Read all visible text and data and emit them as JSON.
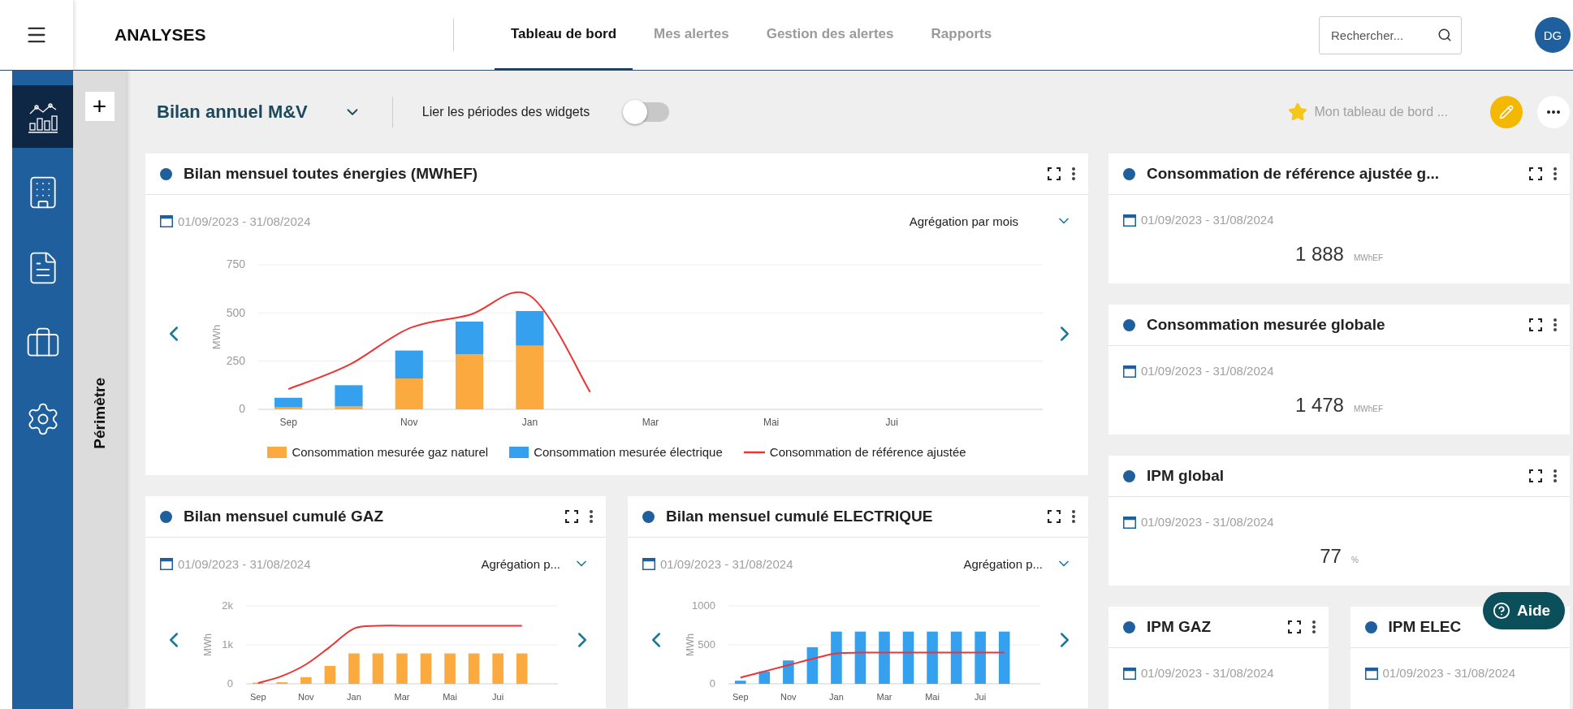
{
  "app_title": "ANALYSES",
  "tabs": [
    {
      "label": "Tableau de bord",
      "selected": true
    },
    {
      "label": "Mes alertes",
      "selected": false
    },
    {
      "label": "Gestion des alertes",
      "selected": false
    },
    {
      "label": "Rapports",
      "selected": false
    }
  ],
  "search": {
    "placeholder": "Rechercher..."
  },
  "avatar": {
    "initials": "DG"
  },
  "sidebar": {
    "items": [
      {
        "kind": "chart",
        "selected": true
      },
      {
        "kind": "building",
        "selected": false
      },
      {
        "kind": "invoice",
        "selected": false
      },
      {
        "kind": "briefcase",
        "selected": false
      },
      {
        "kind": "settings",
        "selected": false
      }
    ]
  },
  "perimeter": {
    "add": "+",
    "label": "Périmètre"
  },
  "dashboard": {
    "name": "Bilan annuel M&V",
    "link_periods": {
      "label": "Lier les périodes des widgets",
      "on": false
    },
    "favorite": {
      "label": "Mon tableau de bord ...",
      "starred": true
    }
  },
  "widgets": [
    {
      "kind": "wide",
      "title": "Bilan mensuel toutes énergies (MWhEF)",
      "period": "01/09/2023 - 31/08/2024",
      "aggregation": "Agrégation par mois",
      "chart_data": {
        "type": "bar",
        "stacked": true,
        "ylabel": "MWh",
        "categories": [
          "Sep",
          null,
          "Nov",
          null,
          "Jan",
          null,
          "Mar",
          null,
          "Mai",
          null,
          "Jui",
          null
        ],
        "ylim": [
          0,
          750
        ],
        "yticks": [
          0,
          250,
          500,
          750
        ],
        "series": [
          {
            "name": "Consommation mesurée gaz naturel",
            "type": "bar",
            "color": "#fbaa3f",
            "values": [
              10,
              15,
              160,
              285,
              330,
              null,
              null,
              null,
              null,
              null,
              null,
              null
            ]
          },
          {
            "name": "Consommation mesurée électrique",
            "type": "bar",
            "color": "#35a0ee",
            "values": [
              50,
              110,
              145,
              170,
              180,
              null,
              null,
              null,
              null,
              null,
              null,
              null
            ]
          },
          {
            "name": "Consommation de référence ajustée",
            "type": "line",
            "color": "#ee3333",
            "values": [
              105,
              230,
              420,
              490,
              590,
              90,
              null,
              null,
              null,
              null,
              null,
              null
            ]
          }
        ]
      }
    },
    {
      "kind": "half",
      "title": "Bilan mensuel cumulé GAZ",
      "period": "01/09/2023 - 31/08/2024",
      "aggregation": "Agrégation p...",
      "chart_data": {
        "type": "bar",
        "ylabel": "MWh",
        "categories": [
          "Sep",
          null,
          "Nov",
          null,
          "Jan",
          null,
          "Mar",
          null,
          "Mai",
          null,
          "Jui",
          null
        ],
        "ylim": [
          0,
          2000
        ],
        "yticks": [
          {
            "value": 0,
            "label": "0"
          },
          {
            "value": 1000,
            "label": "1k"
          },
          {
            "value": 2000,
            "label": "2k"
          }
        ],
        "series": [
          {
            "type": "bar",
            "color": "#fbaa3f",
            "values": [
              30,
              40,
              170,
              460,
              780,
              780,
              780,
              780,
              780,
              780,
              780,
              780
            ]
          },
          {
            "type": "line",
            "color": "#ee3333",
            "values": [
              20,
              200,
              500,
              950,
              1420,
              1490,
              1490,
              1490,
              1490,
              1490,
              1490,
              1490
            ]
          }
        ]
      }
    },
    {
      "kind": "half",
      "title": "Bilan mensuel cumulé ELECTRIQUE",
      "period": "01/09/2023 - 31/08/2024",
      "aggregation": "Agrégation p...",
      "chart_data": {
        "type": "bar",
        "ylabel": "MWh",
        "categories": [
          "Sep",
          null,
          "Nov",
          null,
          "Jan",
          null,
          "Mar",
          null,
          "Mai",
          null,
          "Jui",
          null
        ],
        "ylim": [
          0,
          1000
        ],
        "yticks": [
          0,
          500,
          1000
        ],
        "series": [
          {
            "type": "bar",
            "color": "#35a0ee",
            "values": [
              40,
              160,
              300,
              470,
              670,
              670,
              670,
              670,
              670,
              670,
              670,
              670
            ]
          },
          {
            "type": "line",
            "color": "#ee3333",
            "values": [
              80,
              160,
              240,
              320,
              390,
              400,
              400,
              400,
              400,
              400,
              400,
              400
            ]
          }
        ]
      }
    }
  ],
  "kpi_rows": [
    [
      {
        "title": "Consommation de référence ajustée g...",
        "period": "01/09/2023 - 31/08/2024",
        "value": "1 888",
        "unit": "MWhEF"
      }
    ],
    [
      {
        "title": "Consommation mesurée globale",
        "period": "01/09/2023 - 31/08/2024",
        "value": "1 478",
        "unit": "MWhEF"
      }
    ],
    [
      {
        "title": "IPM global",
        "period": "01/09/2023 - 31/08/2024",
        "value": "77",
        "unit": "%"
      }
    ],
    [
      {
        "title": "IPM GAZ",
        "period": "01/09/2023 - 31/08/2024"
      },
      {
        "title": "IPM ELEC",
        "period": "01/09/2023 - 31/08/2024"
      }
    ]
  ],
  "help_button": {
    "label": "Aide"
  }
}
